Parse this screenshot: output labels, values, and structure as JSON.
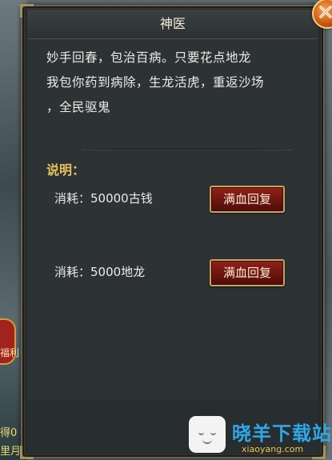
{
  "dialog": {
    "title": "神医",
    "description_lines": [
      "妙手回春，包治百病。只要花点地龙",
      "我包你药到病除，生龙活虎，重返沙场",
      "，全民驱鬼"
    ],
    "section_label": "说明：",
    "options": [
      {
        "cost_label": "消耗：50000古钱",
        "button_label": "满血回复"
      },
      {
        "cost_label": "消耗：5000地龙",
        "button_label": "满血回复"
      }
    ]
  },
  "background": {
    "side_texts": [
      "福利",
      "得0",
      "里月"
    ]
  },
  "watermark": {
    "text": "晓羊下载站",
    "url": "xiaoyang.com"
  },
  "colors": {
    "panel_bg": "#2d3235",
    "title_text": "#f1ead6",
    "section_label": "#e8c35a",
    "button_bg": "#7a1a12",
    "button_border": "#c6a55d",
    "close_button": "#d05a14",
    "watermark": "#2da8e6"
  },
  "icons": {
    "close": "close-x-icon",
    "watermark_logo": "smiley-logo-icon"
  }
}
